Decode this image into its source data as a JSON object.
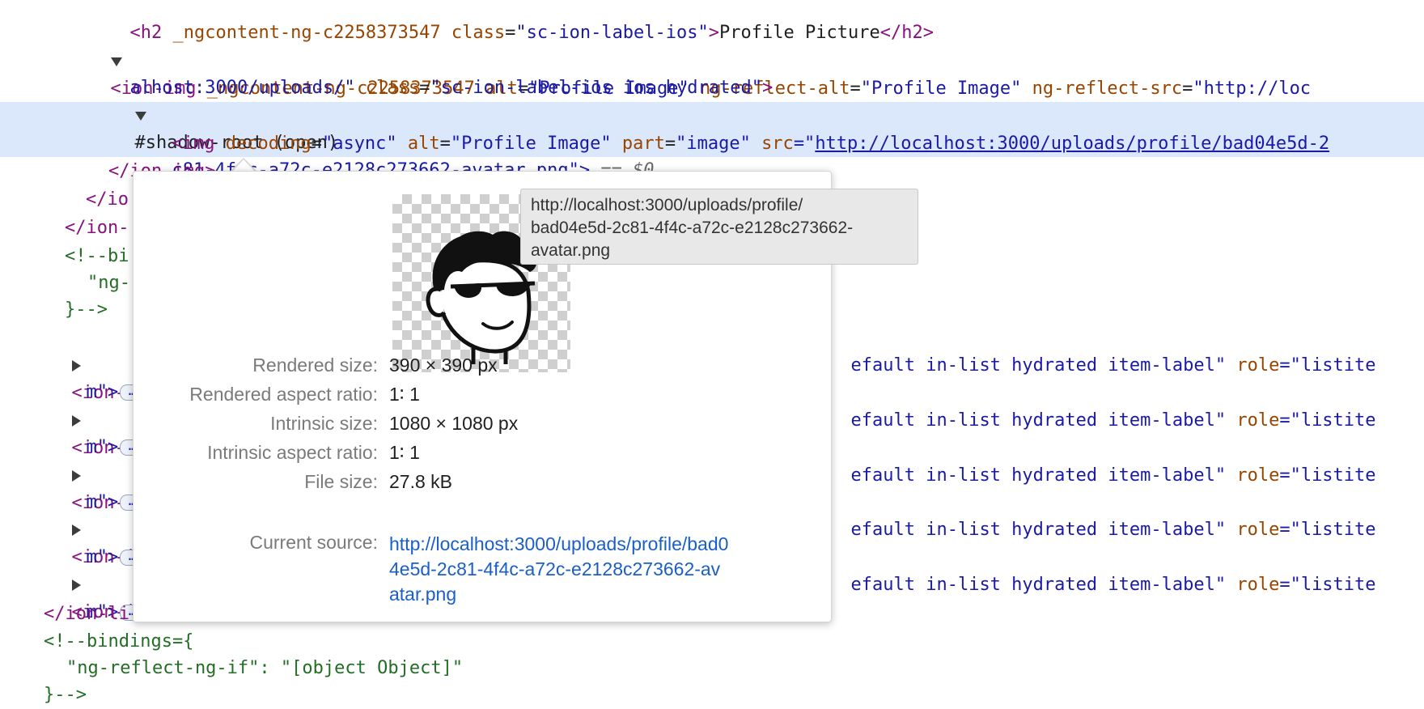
{
  "dom": {
    "l0": {
      "tag_open": "<h2 ",
      "attr1": "_ngcontent-ng-c2258373547",
      "sp": " ",
      "attr2": "class",
      "eq": "=",
      "val2": "\"sc-ion-label-ios\"",
      "close": ">",
      "text": "Profile Picture",
      "end": "</h2>"
    },
    "l1": {
      "tag": "<ion-img ",
      "a1": "_ngcontent-ng-c2258373547",
      "a2": "alt",
      "v2": "\"Profile Image\"",
      "a3": "ng-reflect-alt",
      "v3": "\"Profile Image\"",
      "a4": "ng-reflect-src",
      "v4": "\"http://loc"
    },
    "l2": {
      "v": "alhost:3000/uploads/\"",
      "a": "class",
      "v2": "\"sc-ion-label-ios ios hydrated\"",
      "close": ">"
    },
    "l3": {
      "text": "#shadow-root (open)"
    },
    "l4": {
      "tag": "<img ",
      "a1": "decoding",
      "v1": "\"async\"",
      "a2": "alt",
      "v2": "\"Profile Image\"",
      "a3": "part",
      "v3": "\"image\"",
      "a4": "src",
      "q": "=\"",
      "link": "http://localhost:3000/uploads/profile/bad04e5d-2"
    },
    "l5": {
      "link": "c81-4f4c-a72c-e2128c273662-avatar.png",
      "close": "\">",
      "eq": " == ",
      "dollar": "$0"
    },
    "l6": {
      "text": "</ion-img>"
    },
    "l7": {
      "text": "</io"
    },
    "l8": {
      "text": "</ion-"
    },
    "l9": {
      "text": "<!--bi"
    },
    "l10": {
      "text": "\"ng-"
    },
    "l11": {
      "text": "}-->"
    },
    "items": [
      {
        "tag": "<ion-i",
        "rest_val": "efault in-list hydrated item-label\"",
        "attr": "role",
        "val": "=\"listite",
        "cont": "m\">",
        "ellipsis": "…"
      },
      {
        "tag": "<ion-i",
        "rest_val": "efault in-list hydrated item-label\"",
        "attr": "role",
        "val": "=\"listite",
        "cont": "m\">",
        "ellipsis": "…"
      },
      {
        "tag": "<ion-i",
        "rest_val": "efault in-list hydrated item-label\"",
        "attr": "role",
        "val": "=\"listite",
        "cont": "m\">",
        "ellipsis": "…"
      },
      {
        "tag": "<ion-i",
        "rest_val": "efault in-list hydrated item-label\"",
        "attr": "role",
        "val": "=\"listite",
        "cont": "m\">",
        "ellipsis": "…"
      },
      {
        "tag": "<ion-i",
        "rest_val": "efault in-list hydrated item-label\"",
        "attr": "role",
        "val": "=\"listite",
        "cont": "m\">",
        "ellipsis": "…"
      }
    ],
    "l22": {
      "text": "</ion-li"
    },
    "l23": {
      "text": "<!--bindings={"
    },
    "l24": {
      "text": "\"ng-reflect-ng-if\": \"[object Object]\""
    },
    "l25": {
      "text": "}-->"
    }
  },
  "popover": {
    "tooltip": [
      "http://localhost:3000/uploads/profile/",
      "bad04e5d-2c81-4f4c-a72c-e2128c273662-",
      "avatar.png"
    ],
    "rows": [
      {
        "label": "Rendered size:",
        "value": "390 × 390 px"
      },
      {
        "label": "Rendered aspect ratio:",
        "value": "1∶ 1"
      },
      {
        "label": "Intrinsic size:",
        "value": "1080 × 1080 px"
      },
      {
        "label": "Intrinsic aspect ratio:",
        "value": "1∶ 1"
      },
      {
        "label": "File size:",
        "value": "27.8 kB"
      },
      {
        "label": "Current source:",
        "value": ""
      }
    ],
    "source_lines": [
      "http://localhost:3000/uploads/profile/bad0",
      "4e5d-2c81-4f4c-a72c-e2128c273662-av",
      "atar.png"
    ]
  },
  "colors": {
    "tag": "#881280",
    "attr": "#994500",
    "value": "#1a1aa6",
    "comment": "#236e25",
    "selection": "#dbe7fb"
  },
  "icons": [
    "expand-triangle-icon",
    "collapsed-triangle-icon",
    "ellipsis-icon",
    "avatar-image"
  ]
}
